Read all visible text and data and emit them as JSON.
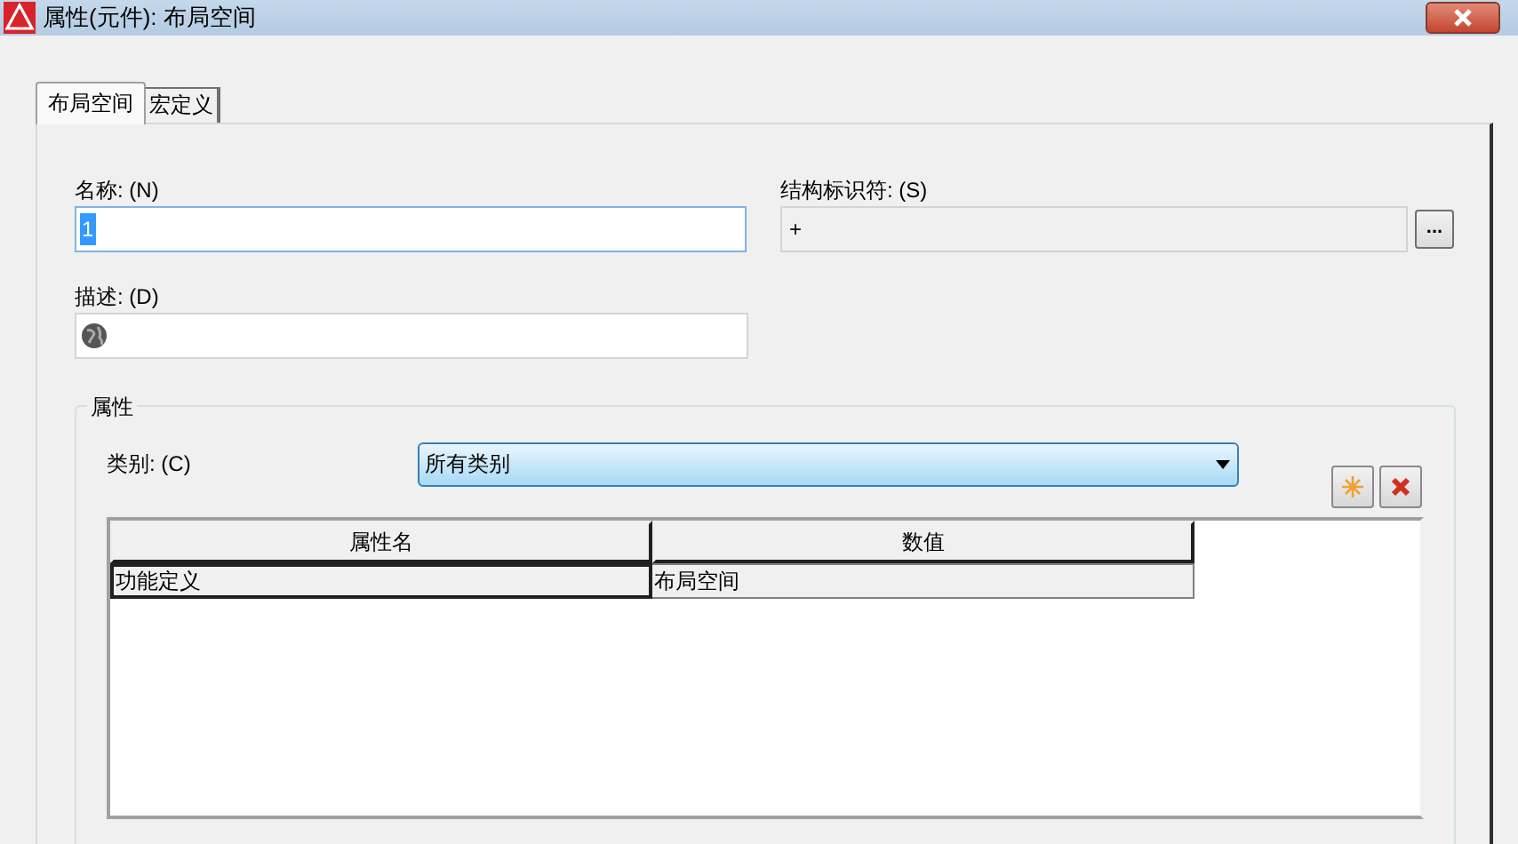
{
  "window": {
    "title": "属性(元件): 布局空间"
  },
  "tabs": [
    {
      "label": "布局空间",
      "selected": true
    },
    {
      "label": "宏定义",
      "selected": false
    }
  ],
  "name_field": {
    "label": "名称: (N)",
    "value": "1"
  },
  "identifier_field": {
    "label": "结构标识符: (S)",
    "value": "+",
    "browse_button": "..."
  },
  "description_field": {
    "label": "描述: (D)"
  },
  "properties": {
    "title": "属性",
    "category_label": "类别: (C)",
    "category_value": "所有类别",
    "table": {
      "columns": [
        "属性名",
        "数值"
      ],
      "rows": [
        {
          "cells": [
            "功能定义",
            "布局空间"
          ]
        }
      ]
    }
  }
}
